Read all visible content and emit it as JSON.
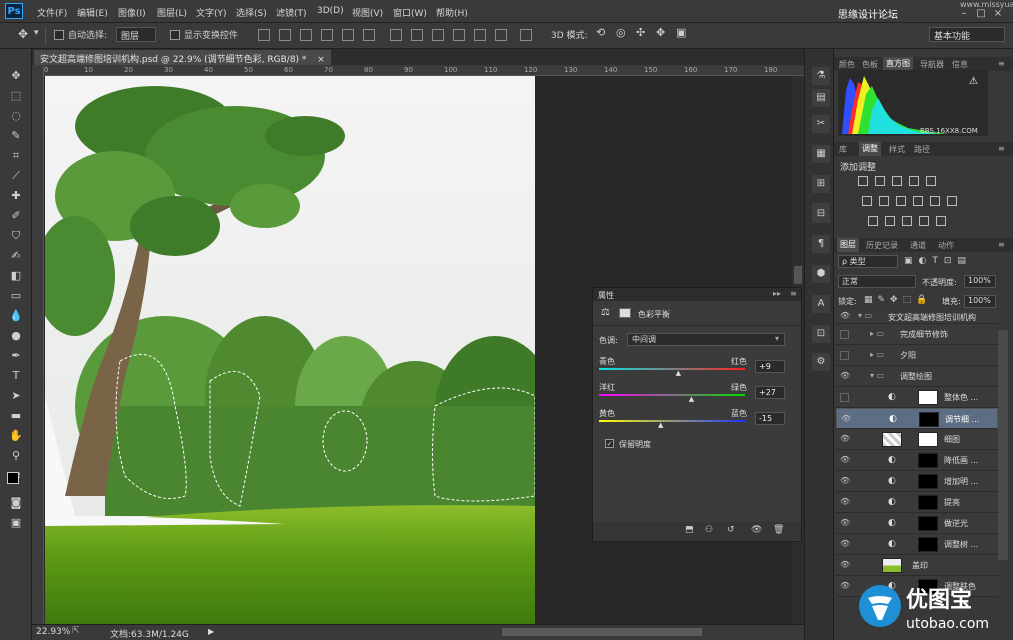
{
  "app": {
    "logo": "Ps"
  },
  "menu": [
    "文件(F)",
    "编辑(E)",
    "图像(I)",
    "图层(L)",
    "文字(Y)",
    "选择(S)",
    "滤镜(T)",
    "3D(D)",
    "视图(V)",
    "窗口(W)",
    "帮助(H)"
  ],
  "watermark": {
    "text": "思缘设计论坛",
    "sub": "www.missyuan.com"
  },
  "options": {
    "auto_select_label": "自动选择:",
    "auto_select_value": "图层",
    "show_transform_label": "显示变换控件",
    "mode_3d_label": "3D 模式:",
    "workspace": "基本功能"
  },
  "document": {
    "tab_title": "安文超高端修图培训机构.psd @ 22.9% (调节细节色彩, RGB/8) *",
    "ruler_marks": [
      "0",
      "10",
      "20",
      "30",
      "40",
      "50",
      "60",
      "70",
      "80",
      "90",
      "100",
      "110",
      "120",
      "130",
      "140",
      "150",
      "160",
      "170",
      "180",
      "190"
    ],
    "zoom": "22.93%",
    "doc_info": "文档:63.3M/1.24G"
  },
  "panels": {
    "top_tabs": [
      "颜色",
      "色板",
      "直方图",
      "导航器",
      "信息"
    ],
    "histogram_url": "BBS.16XX8.COM",
    "adj_tabs": [
      "库",
      "调整",
      "样式",
      "路径"
    ],
    "adj_title": "添加调整",
    "layers_tabs": [
      "图层",
      "历史记录",
      "通道",
      "动作"
    ],
    "filter_kind": "ρ 类型",
    "blend_mode": "正常",
    "opacity_label": "不透明度:",
    "opacity_value": "100%",
    "lock_label": "锁定:",
    "fill_label": "填充:",
    "fill_value": "100%"
  },
  "layers": [
    {
      "name": "安文超高端修图培训机构",
      "type": "group"
    },
    {
      "name": "完成细节修饰",
      "type": "group"
    },
    {
      "name": "夕阳",
      "type": "group"
    },
    {
      "name": "调整绘图",
      "type": "group"
    },
    {
      "name": "整体色 ...",
      "type": "adj"
    },
    {
      "name": "调节细 ...",
      "type": "adj",
      "selected": true
    },
    {
      "name": "细图",
      "type": "pixel"
    },
    {
      "name": "降低画 ...",
      "type": "adj"
    },
    {
      "name": "增加明 ...",
      "type": "adj"
    },
    {
      "name": "提亮",
      "type": "adj"
    },
    {
      "name": "做逆光",
      "type": "adj"
    },
    {
      "name": "调整树 ...",
      "type": "adj"
    },
    {
      "name": "盖印",
      "type": "pixel"
    },
    {
      "name": "调整肤色",
      "type": "adj"
    }
  ],
  "properties": {
    "panel_title": "属性",
    "adj_name": "色彩平衡",
    "tone_label": "色调:",
    "tone_value": "中间调",
    "sliders": [
      {
        "left": "青色",
        "right": "红色",
        "value": "+9",
        "pos": 0.545,
        "grad": "linear-gradient(90deg,#00e5e5,#ff2020)"
      },
      {
        "left": "洋红",
        "right": "绿色",
        "value": "+27",
        "pos": 0.635,
        "grad": "linear-gradient(90deg,#ff00ff,#00dd00)"
      },
      {
        "left": "黄色",
        "right": "蓝色",
        "value": "-15",
        "pos": 0.425,
        "grad": "linear-gradient(90deg,#ffff00,#2030ff)"
      }
    ],
    "preserve_label": "保留明度"
  },
  "brand": {
    "name": "优图宝",
    "url": "utobao.com"
  }
}
